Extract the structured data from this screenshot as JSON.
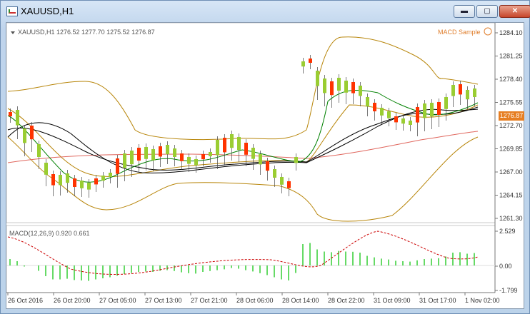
{
  "window": {
    "title": "XAUUSD,H1",
    "buttons": {
      "minimize": "▬",
      "maximize": "▢",
      "close": "✕"
    }
  },
  "main_panel": {
    "header": "XAUUSD,H1  1276.52 1277.70 1275.52 1276.87",
    "indicator_label": "MACD Sample",
    "current_price": "1276.87",
    "price_axis": [
      "1284.10",
      "1281.25",
      "1278.40",
      "1275.55",
      "1272.70",
      "1269.85",
      "1267.00",
      "1264.15",
      "1261.30"
    ]
  },
  "sub_panel": {
    "header": "MACD(12,26,9) 0.920 0.661",
    "axis": [
      "2.529",
      "0.00",
      "-1.799"
    ]
  },
  "time_axis": [
    "26 Oct 2016",
    "26 Oct 20:00",
    "27 Oct 05:00",
    "27 Oct 13:00",
    "27 Oct 21:00",
    "28 Oct 06:00",
    "28 Oct 14:00",
    "28 Oct 22:00",
    "31 Oct 09:00",
    "31 Oct 17:00",
    "1 Nov 02:00"
  ],
  "colors": {
    "bull": "#9acd32",
    "bear": "#ff3300",
    "bands": "#b8860b",
    "ma_fast": "#008000",
    "ma_slow": "#000000",
    "ma_long": "#e0675e",
    "macd_signal": "#cc0000",
    "macd_hist": "#32cd32"
  }
}
